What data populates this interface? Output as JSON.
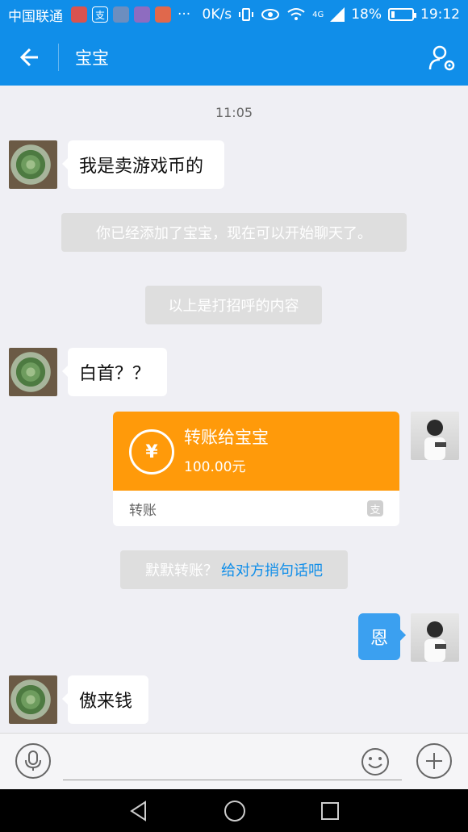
{
  "status_bar": {
    "carrier": "中国联通",
    "network_speed": "0K/s",
    "signal_type": "4G",
    "battery": "18%",
    "battery_level": 0.18,
    "time": "19:12",
    "overflow": "···",
    "alipay_glyph": "支"
  },
  "header": {
    "title": "宝宝"
  },
  "chat": {
    "timestamp": "11:05",
    "messages": [
      {
        "text": "我是卖游戏币的"
      },
      {
        "text": "白首？？"
      },
      {
        "text": "恩"
      },
      {
        "text": "傲来钱"
      }
    ],
    "system_notices": [
      {
        "text": "你已经添加了宝宝，现在可以开始聊天了。"
      },
      {
        "text": "以上是打招呼的内容"
      }
    ],
    "transfer_card": {
      "title": "转账给宝宝",
      "amount": "100.00元",
      "footer_label": "转账",
      "coin_symbol": "¥"
    },
    "transfer_prompt": {
      "text": "默默转账？",
      "link": "给对方捎句话吧"
    }
  },
  "colors": {
    "brand_blue": "#108ee9",
    "transfer_orange": "#ff9a0a",
    "bubble_blue": "#3ba0f0"
  },
  "icons": {
    "back": "arrow-left-icon",
    "profile": "profile-settings-icon",
    "voice": "microphone-icon",
    "emoji": "smiley-icon",
    "more": "plus-icon"
  }
}
